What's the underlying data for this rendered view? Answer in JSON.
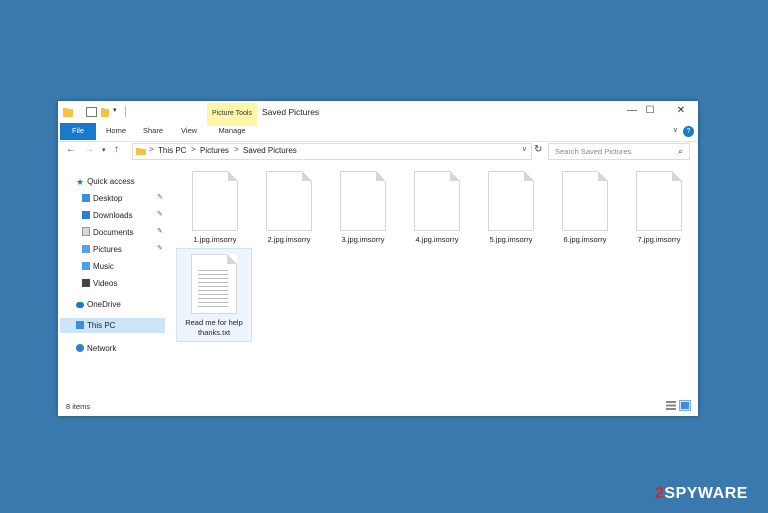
{
  "window": {
    "title": "Saved Pictures",
    "contextual_tab": "Picture Tools",
    "buttons": {
      "minimize": "—",
      "maximize": "☐",
      "close": "✕"
    }
  },
  "ribbon": {
    "tabs": [
      "File",
      "Home",
      "Share",
      "View",
      "Manage"
    ],
    "expand_glyph": "∨",
    "help_glyph": "?"
  },
  "address": {
    "breadcrumbs": [
      "This PC",
      "Pictures",
      "Saved Pictures"
    ],
    "separator": ">",
    "search_placeholder": "Search Saved Pictures"
  },
  "navigation": {
    "quick_access": "Quick access",
    "pinned": [
      "Desktop",
      "Downloads",
      "Documents",
      "Pictures"
    ],
    "unpinned": [
      "Music",
      "Videos"
    ],
    "onedrive": "OneDrive",
    "this_pc": "This PC",
    "network": "Network"
  },
  "files": [
    {
      "name": "1.jpg.imsorry"
    },
    {
      "name": "2.jpg.imsorry"
    },
    {
      "name": "3.jpg.imsorry"
    },
    {
      "name": "4.jpg.imsorry"
    },
    {
      "name": "5.jpg.imsorry"
    },
    {
      "name": "6.jpg.imsorry"
    },
    {
      "name": "7.jpg.imsorry"
    },
    {
      "name": "Read me for help thanks.txt"
    }
  ],
  "status": {
    "item_count": "8 items"
  },
  "watermark": {
    "prefix": "2",
    "text": "SPYWARE"
  },
  "colors": {
    "background": "#3a79ad",
    "accent": "#1979ca",
    "picture_tools": "#fdf6a8"
  }
}
